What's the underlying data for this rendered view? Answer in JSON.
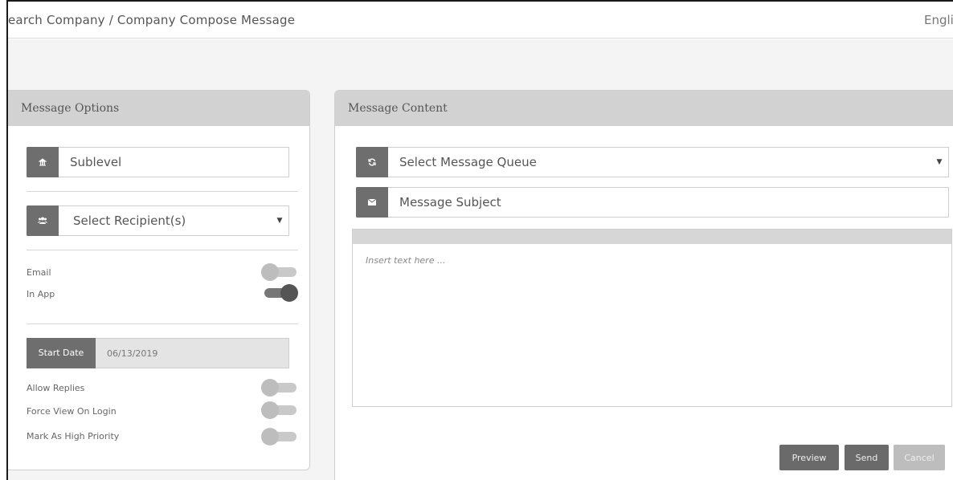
{
  "header": {
    "breadcrumb": "earch Company / Company Compose Message",
    "language": "Englis"
  },
  "message_options": {
    "title": "Message Options",
    "sublevel": {
      "value": "Sublevel",
      "icon": "building-icon"
    },
    "recipients": {
      "value": "Select Recipient(s)",
      "icon": "users-icon"
    },
    "toggles": [
      {
        "label": "Email",
        "on": false
      },
      {
        "label": "In App",
        "on": true
      }
    ],
    "start_date": {
      "label": "Start Date",
      "value": "06/13/2019"
    },
    "options": [
      {
        "label": "Allow Replies",
        "on": false
      },
      {
        "label": "Force View On Login",
        "on": false
      },
      {
        "label": "Mark As High Priority",
        "on": false
      }
    ]
  },
  "message_content": {
    "title": "Message Content",
    "queue": {
      "value": "Select Message Queue",
      "icon": "refresh-icon"
    },
    "subject": {
      "placeholder": "Message Subject",
      "icon": "envelope-icon"
    },
    "editor": {
      "placeholder": "Insert text here ..."
    }
  },
  "buttons": {
    "preview": "Preview",
    "send": "Send",
    "cancel": "Cancel"
  },
  "colors": {
    "header_bg": "#d2d2d2",
    "icon_bg": "#6e6e6e",
    "toggle_on": "#555555",
    "toggle_off": "#bdbdbd"
  }
}
